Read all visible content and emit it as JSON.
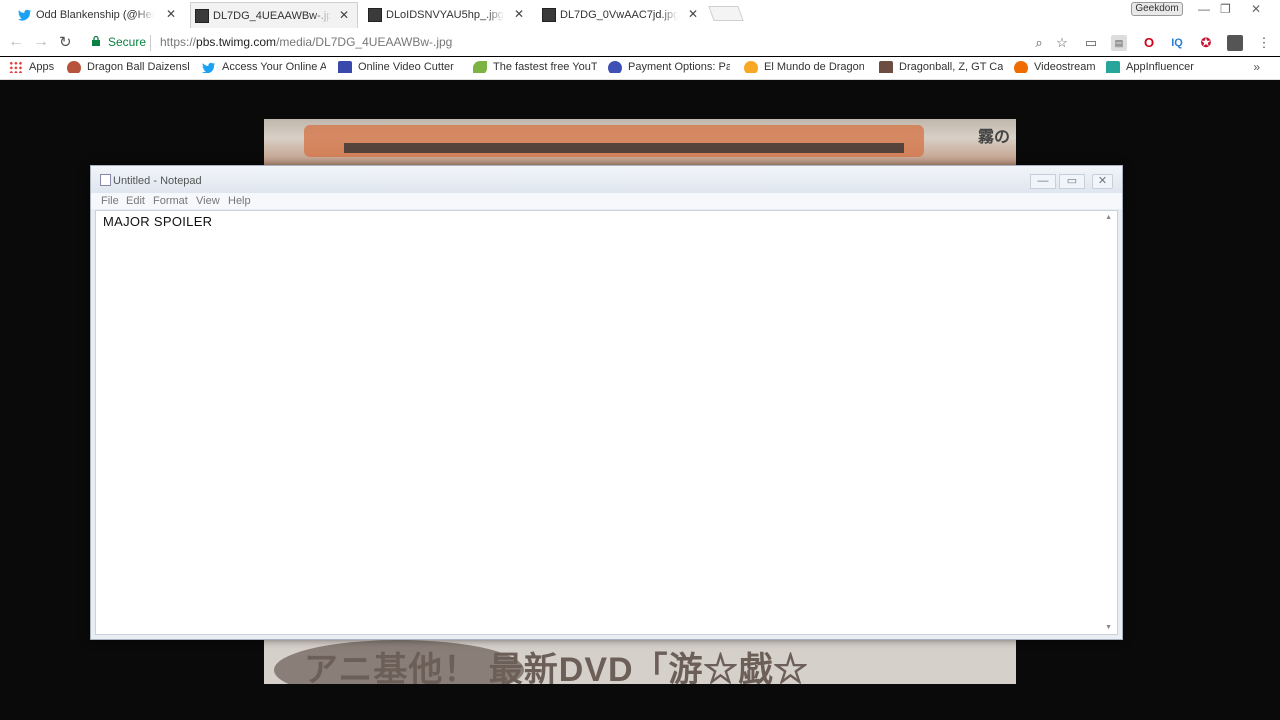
{
  "browser": {
    "tabs": [
      {
        "label": "Odd Blankenship (@Herm",
        "icon": "twitter-icon"
      },
      {
        "label": "DL7DG_4UEAAWBw-.jpg",
        "icon": "image-icon"
      },
      {
        "label": "DLoIDSNVYAU5hp_.jpg",
        "icon": "image-icon"
      },
      {
        "label": "DL7DG_0VwAAC7jd.jpg",
        "icon": "image-icon"
      }
    ],
    "profile_badge": "Geekdom",
    "secure_label": "Secure",
    "url_prefix": "https://",
    "url_host": "pbs.twimg.com",
    "url_path": "/media/DL7DG_4UEAAWBw-.jpg",
    "bookmarks": [
      {
        "label": "Apps"
      },
      {
        "label": "Dragon Ball Daizensh"
      },
      {
        "label": "Access Your Online A"
      },
      {
        "label": "Online Video Cutter"
      },
      {
        "label": "The fastest free YouT"
      },
      {
        "label": "Payment Options: Pa"
      },
      {
        "label": "El Mundo de Dragon"
      },
      {
        "label": "Dragonball, Z, GT Ca"
      },
      {
        "label": "Videostream"
      },
      {
        "label": "AppInfluencer"
      }
    ],
    "bookmarks_more": "»"
  },
  "background_image": {
    "top_kanji": "霧の",
    "bottom_caption": "アニ基他！ 最新DVD「游☆戯☆"
  },
  "notepad": {
    "title": "Untitled - Notepad",
    "menu": [
      "File",
      "Edit",
      "Format",
      "View",
      "Help"
    ],
    "content": "MAJOR SPOILER"
  },
  "colors": {
    "secure_green": "#0b8043",
    "page_bg": "#0a0a0a"
  }
}
